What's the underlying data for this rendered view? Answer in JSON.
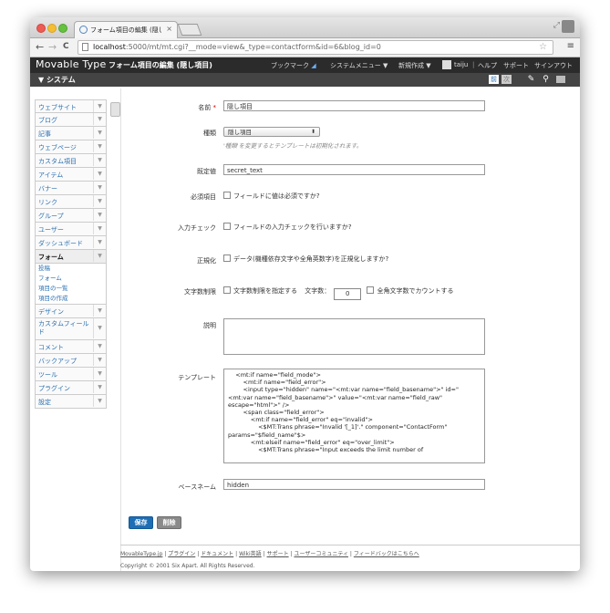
{
  "browser": {
    "tab_title": "フォーム項目の編集 (隠し項",
    "tab_close": "×",
    "url_host": "localhost",
    "url_rest": ":5000/mt/mt.cgi?__mode=view&_type=contactform&id=6&blog_id=0",
    "back": "←",
    "forward": "→",
    "reload": "C",
    "star": "☆",
    "menu": "≡",
    "resize": "⤢"
  },
  "header": {
    "logo": "Movable Type",
    "page_title": "フォーム項目の編集 (隠し項目)",
    "bookmark": "ブックマーク",
    "system_menu": "システムメニュー ▼",
    "new": "新規作成 ▼",
    "user": "taiju",
    "help": "ヘルプ",
    "support": "サポート",
    "signout": "サインアウト"
  },
  "blogbar": {
    "label": "▼ システム",
    "prev": "前",
    "next": "次"
  },
  "sidebar": {
    "items": [
      {
        "label": "ウェブサイト"
      },
      {
        "label": "ブログ"
      },
      {
        "label": "記事"
      },
      {
        "label": "ウェブページ"
      },
      {
        "label": "カスタム項目"
      },
      {
        "label": "アイテム"
      },
      {
        "label": "バナー"
      },
      {
        "label": "リンク"
      },
      {
        "label": "グループ"
      },
      {
        "label": "ユーザー"
      },
      {
        "label": "ダッシュボード"
      }
    ],
    "active": "フォーム",
    "subitems": [
      "投稿",
      "フォーム",
      "項目の一覧",
      "項目の作成"
    ],
    "items2": [
      {
        "label": "デザイン"
      },
      {
        "label": "カスタムフィールド"
      },
      {
        "label": "コメント"
      },
      {
        "label": "バックアップ"
      },
      {
        "label": "ツール"
      },
      {
        "label": "プラグイン"
      },
      {
        "label": "設定"
      }
    ],
    "arrow": "▼"
  },
  "form": {
    "name_label": "名前",
    "required_mark": "*",
    "name_value": "隠し項目",
    "type_label": "種類",
    "type_value": "隠し項目",
    "type_caret": "⬍",
    "type_hint": "'種類'を変更するとテンプレートは初期化されます。",
    "default_label": "既定値",
    "default_value": "secret_text",
    "required_label": "必須項目",
    "required_text": "フィールドに値は必須ですか?",
    "check_label": "入力チェック",
    "check_text": "フィールドの入力チェックを行いますか?",
    "normalize_label": "正規化",
    "normalize_text": "データ(機種依存文字や全角英数字)を正規化しますか?",
    "charlimit_label": "文字数制限",
    "charlimit_text": "文字数制限を指定する",
    "charcount_label": "文字数：",
    "charcount_value": "0",
    "fullwidth_text": "全角文字数でカウントする",
    "description_label": "説明",
    "description_value": "",
    "template_label": "テンプレート",
    "template_value": "    <mt:if name=\"field_mode\">\n        <mt:if name=\"field_error\">\n        <input type=\"hidden\" name=\"<mt:var name=\"field_basename\">\" id=\"<mt:var name=\"field_basename\">\" value=\"<mt:var name=\"field_raw\" escape=\"html\">\" />\n        <span class=\"field_error\">\n            <mt:if name=\"field_error\" eq=\"invalid\">\n                <$MT:Trans phrase=\"Invalid '[_1]'.\" component=\"ContactForm\" params=\"$field_name\"$>\n            <mt:elseif name=\"field_error\" eq=\"over_limit\">\n                <$MT:Trans phrase=\"Input exceeds the limit number of",
    "basename_label": "ベースネーム",
    "basename_value": "hidden",
    "save": "保存",
    "delete": "削除"
  },
  "footer": {
    "links": [
      "MovableType.jp",
      "プラグイン",
      "ドキュメント",
      "Wiki英語",
      "サポート",
      "ユーザーコミュニティ",
      "フィードバックはこちらへ"
    ],
    "separator": "|",
    "copyright": "Copyright © 2001 Six Apart. All Rights Reserved."
  }
}
